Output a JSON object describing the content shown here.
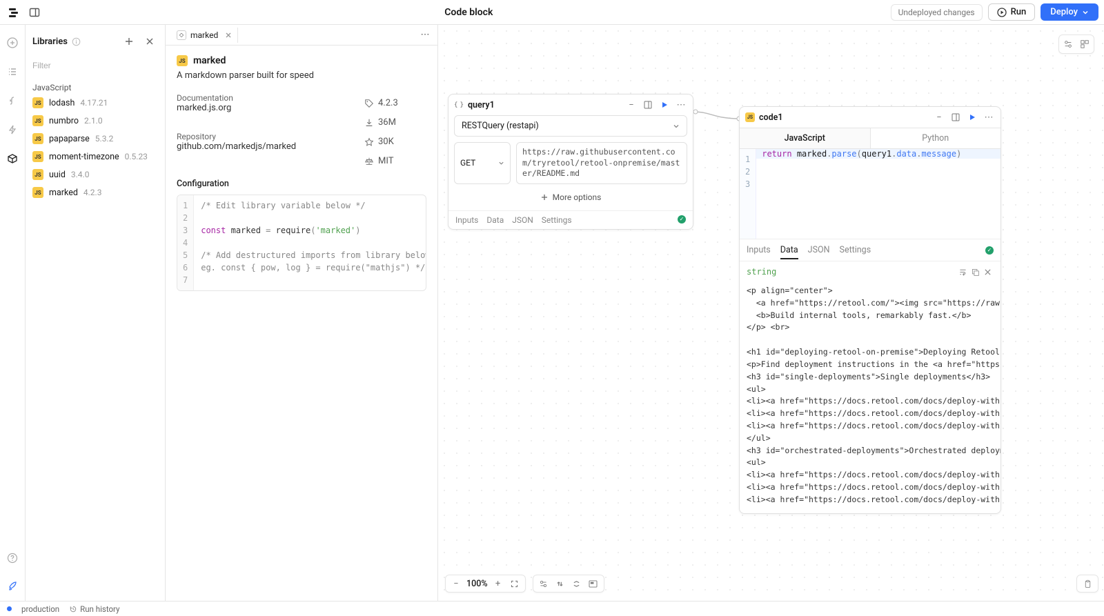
{
  "header": {
    "title": "Code block",
    "undeployed": "Undeployed changes",
    "run": "Run",
    "deploy": "Deploy"
  },
  "sidebar": {
    "title": "Libraries",
    "filter_placeholder": "Filter",
    "section": "JavaScript",
    "items": [
      {
        "name": "lodash",
        "version": "4.17.21"
      },
      {
        "name": "numbro",
        "version": "2.1.0"
      },
      {
        "name": "papaparse",
        "version": "5.3.2"
      },
      {
        "name": "moment-timezone",
        "version": "0.5.23"
      },
      {
        "name": "uuid",
        "version": "3.4.0"
      },
      {
        "name": "marked",
        "version": "4.2.3"
      }
    ]
  },
  "detail": {
    "tab_label": "marked",
    "title": "marked",
    "description": "A markdown parser built for speed",
    "docs_label": "Documentation",
    "docs_link": "marked.js.org",
    "repo_label": "Repository",
    "repo_link": "github.com/markedjs/marked",
    "version": "4.2.3",
    "downloads": "36M",
    "stars": "30K",
    "license": "MIT",
    "config_label": "Configuration",
    "code_lines": [
      "/* Edit library variable below */",
      "",
      "const marked = require('marked')",
      "",
      "/* Add destructured imports from library below",
      "eg. const { pow, log } = require(\"mathjs\") */",
      ""
    ]
  },
  "query_block": {
    "name": "query1",
    "resource": "RESTQuery (restapi)",
    "method": "GET",
    "url": "https://raw.githubusercontent.com/tryretool/retool-onpremise/master/README.md",
    "more_options": "More options",
    "tabs": [
      "Inputs",
      "Data",
      "JSON",
      "Settings"
    ]
  },
  "code_block": {
    "name": "code1",
    "lang_tabs": [
      "JavaScript",
      "Python"
    ],
    "code_display": "return marked.parse(query1.data.message)",
    "foot_tabs": [
      "Inputs",
      "Data",
      "JSON",
      "Settings"
    ],
    "output_type": "string",
    "output_text": "<p align=\"center\">\n  <a href=\"https://retool.com/\"><img src=\"https://raw.githu\n  <b>Build internal tools, remarkably fast.</b>\n</p> <br>\n\n<h1 id=\"deploying-retool-on-premise\">Deploying Retool on-prem\n<p>Find deployment instructions in the <a href=\"https://docs.\n<h3 id=\"single-deployments\">Single deployments</h3>\n<ul>\n<li><a href=\"https://docs.retool.com/docs/deploy-with-aws-ec2\n<li><a href=\"https://docs.retool.com/docs/deploy-with-gcp\">GC\n<li><a href=\"https://docs.retool.com/docs/deploy-with-azure-v\n</ul>\n<h3 id=\"orchestrated-deployments\">Orchestrated deployments</h\n<ul>\n<li><a href=\"https://docs.retool.com/docs/deploy-with-kuberne\n<li><a href=\"https://docs.retool.com/docs/deploy-with-helm\">K\n<li><a href=\"https://docs.retool.com/docs/deploy-with-ecs-far"
  },
  "bottom": {
    "zoom": "100%"
  },
  "statusbar": {
    "env": "production",
    "run_history": "Run history"
  }
}
